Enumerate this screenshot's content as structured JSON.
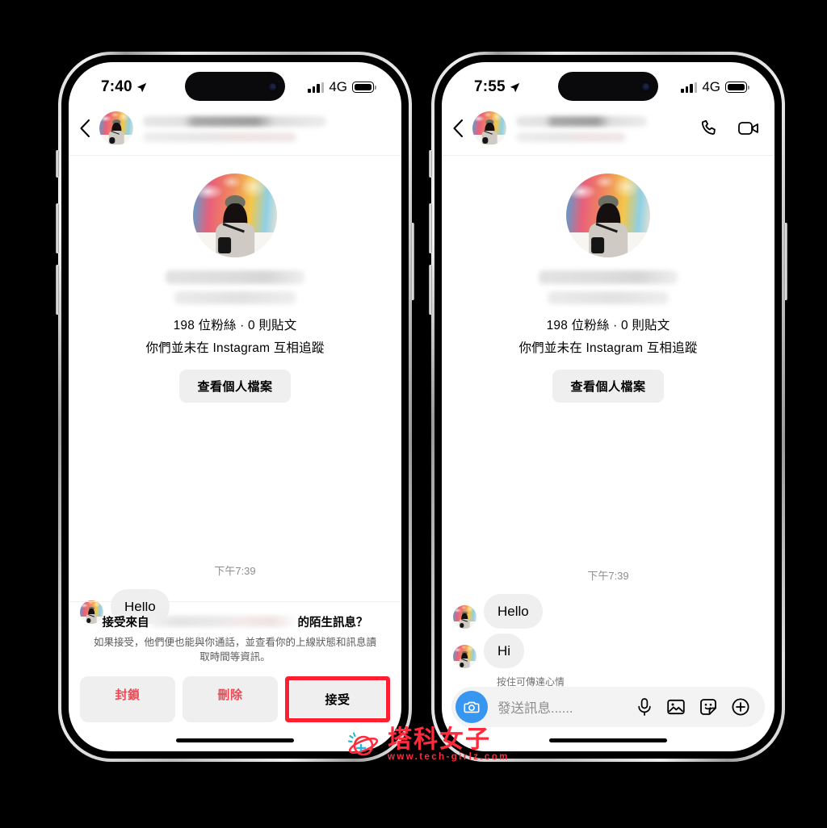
{
  "phones": [
    {
      "id": "left",
      "status": {
        "time": "7:40",
        "network": "4G",
        "location_icon": "location-arrow-icon"
      },
      "header": {
        "back_icon": "back-chevron-icon",
        "avatar": "contact-avatar"
      },
      "profile": {
        "stats": "198 位粉絲 · 0 則貼文",
        "relationship": "你們並未在 Instagram 互相追蹤",
        "view_profile_label": "查看個人檔案"
      },
      "conversation": {
        "timestamp": "下午7:39",
        "messages": [
          {
            "text": "Hello",
            "from": "them"
          }
        ]
      },
      "request_banner": {
        "title_prefix": "接受來自",
        "title_suffix": "的陌生訊息？",
        "subtitle": "如果接受，他們便也能與你通話，並查看你的上線狀態和訊息讀取時間等資訊。",
        "buttons": [
          {
            "label": "封鎖",
            "style": "danger",
            "highlighted": false
          },
          {
            "label": "刪除",
            "style": "danger",
            "highlighted": false
          },
          {
            "label": "接受",
            "style": "accept",
            "highlighted": true
          }
        ]
      }
    },
    {
      "id": "right",
      "status": {
        "time": "7:55",
        "network": "4G",
        "location_icon": "location-arrow-icon"
      },
      "header": {
        "back_icon": "back-chevron-icon",
        "avatar": "contact-avatar",
        "call_icon": "phone-call-icon",
        "video_icon": "video-call-icon"
      },
      "profile": {
        "stats": "198 位粉絲 · 0 則貼文",
        "relationship": "你們並未在 Instagram 互相追蹤",
        "view_profile_label": "查看個人檔案"
      },
      "conversation": {
        "timestamp": "下午7:39",
        "messages": [
          {
            "text": "Hello",
            "from": "them"
          },
          {
            "text": "Hi",
            "from": "them"
          }
        ],
        "reaction_hint": "按住可傳達心情"
      },
      "input_bar": {
        "camera_icon": "camera-icon",
        "placeholder": "發送訊息......",
        "icons": [
          "microphone-icon",
          "photo-icon",
          "sticker-icon",
          "plus-icon"
        ]
      }
    }
  ],
  "watermark": {
    "title": "塔科女子",
    "url": "www.tech-girlz.com"
  },
  "colors": {
    "accent_blue": "#3797f0",
    "danger_red": "#ed4956",
    "highlight_red": "#ff1f30",
    "bubble_gray": "#efefef"
  }
}
